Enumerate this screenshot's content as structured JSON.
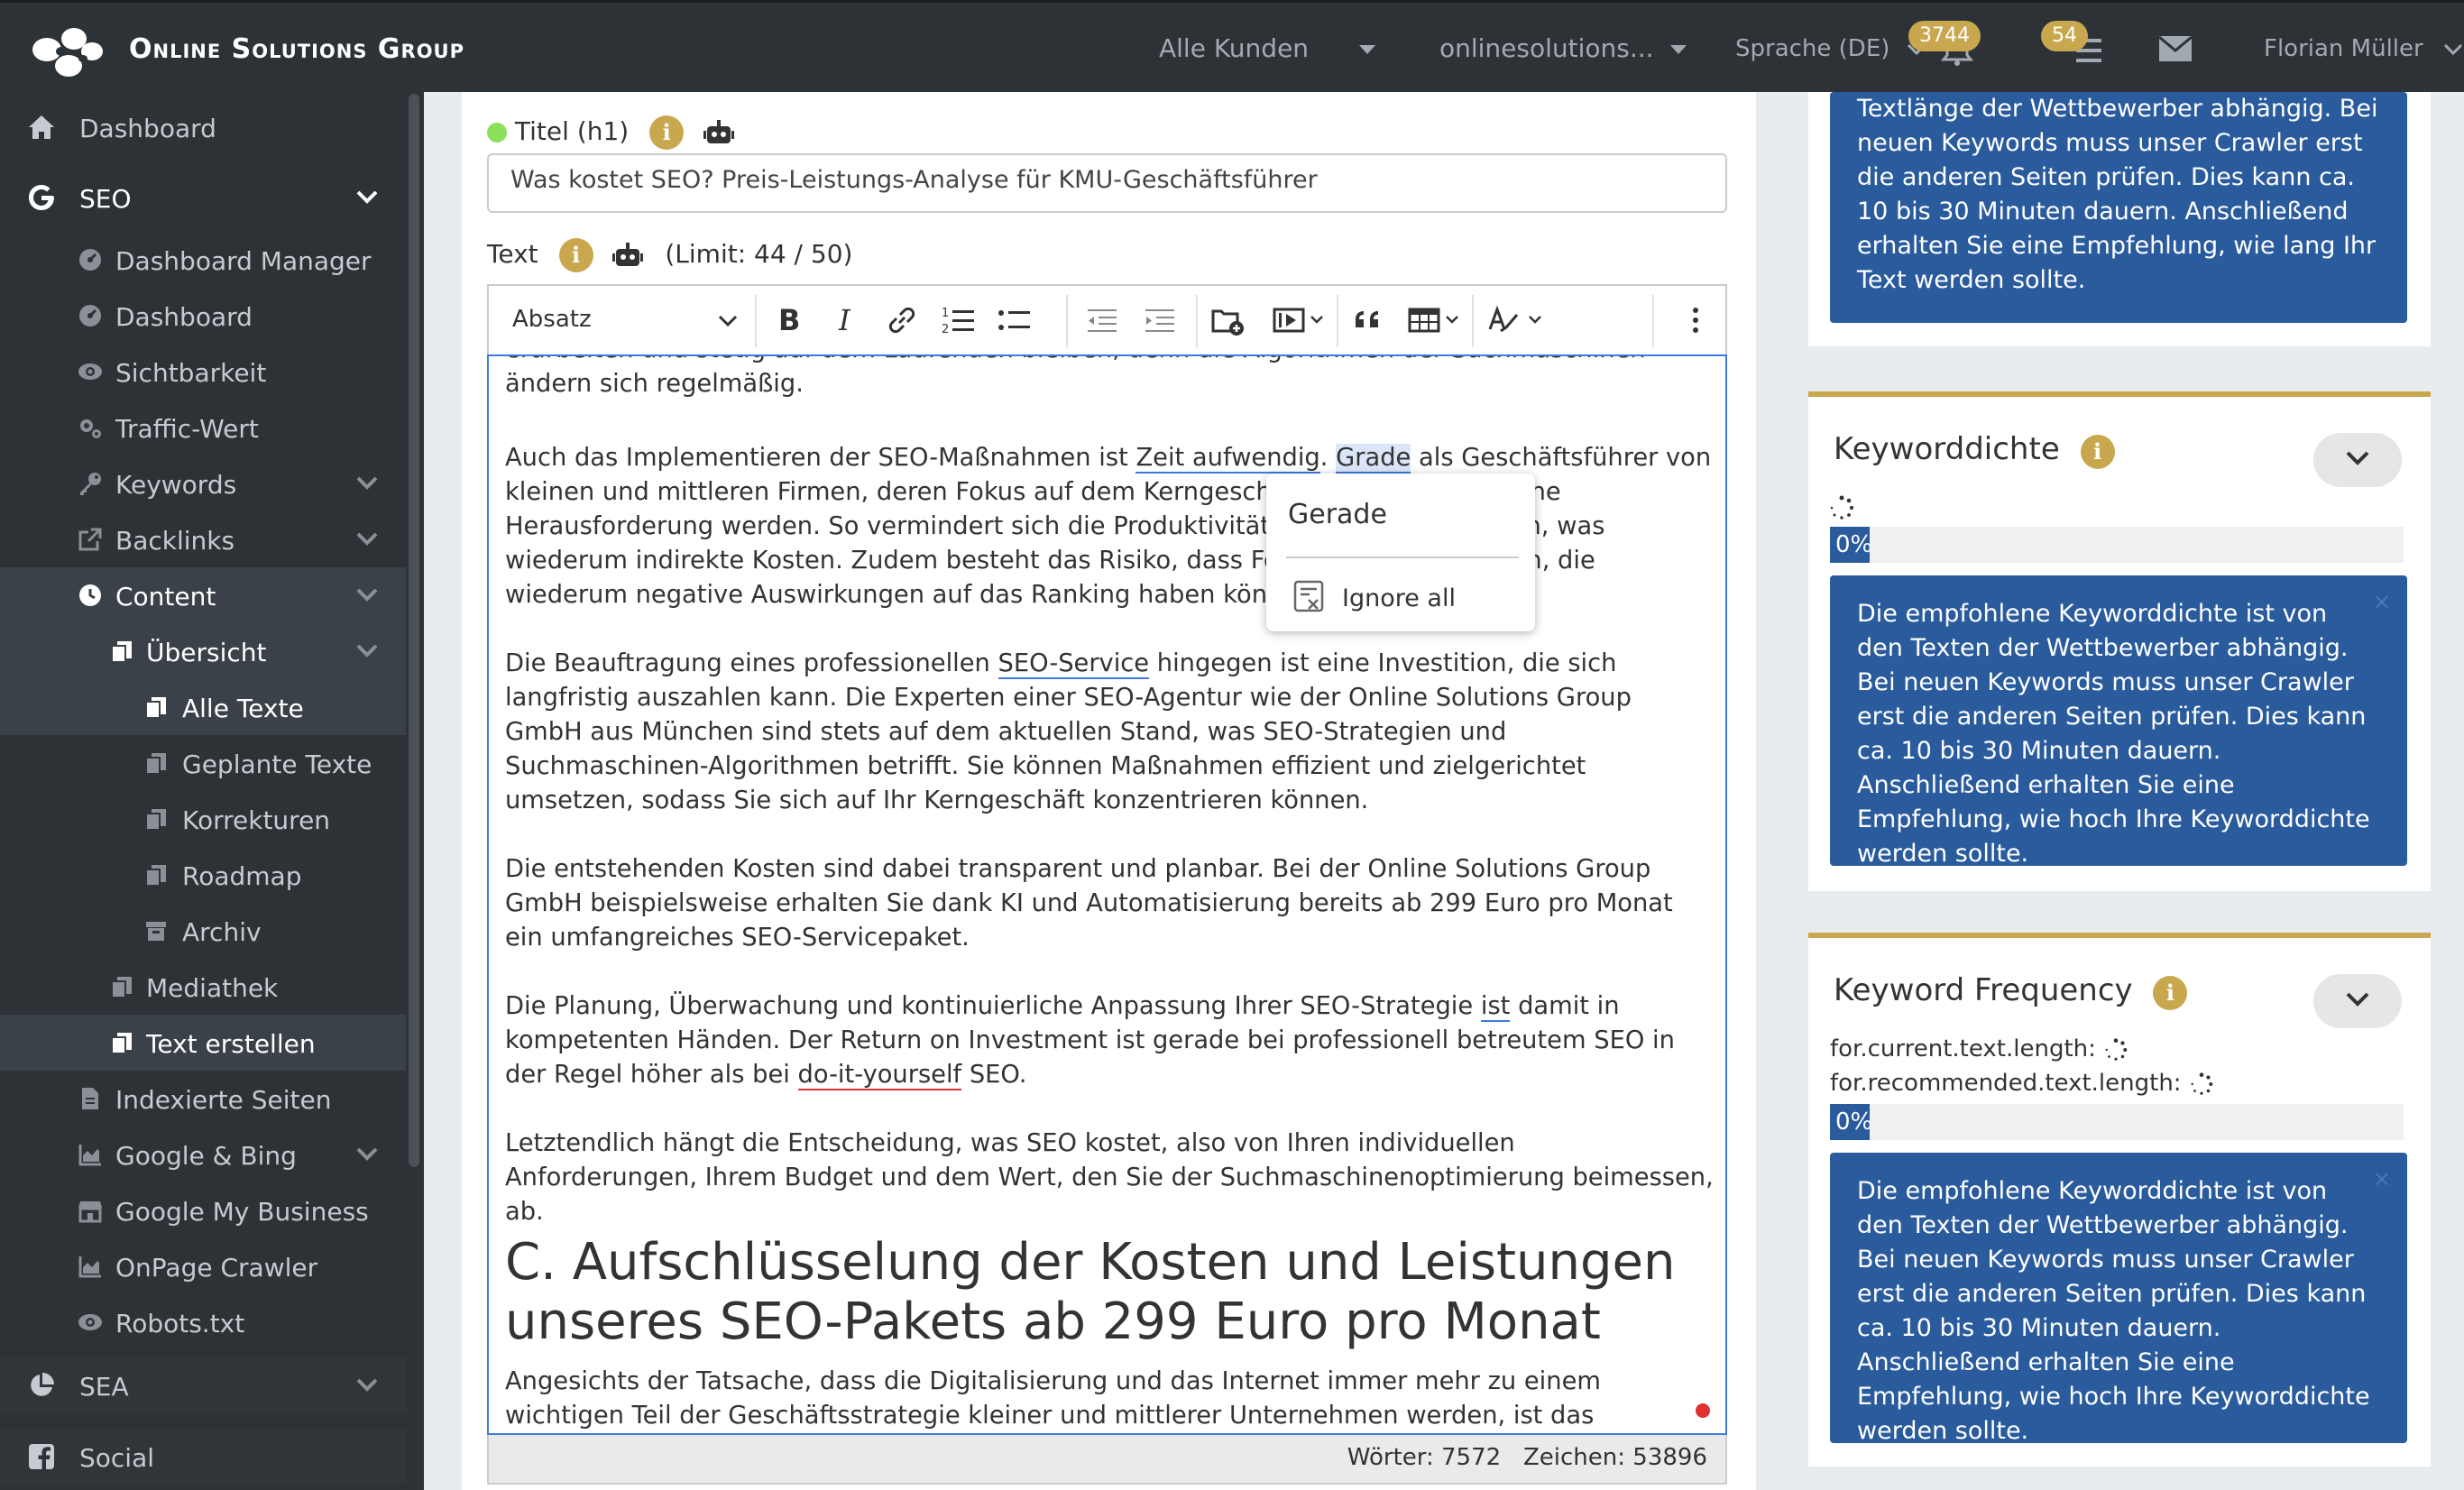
{
  "topbar": {
    "brand": "Online Solutions Group",
    "customers": "Alle Kunden",
    "domain": "onlinesolutions...",
    "language": "Sprache (DE)",
    "notif_count": "3744",
    "tasks_count": "54",
    "user": "Florian Müller"
  },
  "sidebar": {
    "items": [
      {
        "label": "Dashboard",
        "icon": "home-icon"
      },
      {
        "label": "SEO",
        "icon": "google-icon"
      },
      {
        "label": "Dashboard Manager",
        "icon": "dashboard-gauge-icon"
      },
      {
        "label": "Dashboard",
        "icon": "dashboard-gauge-icon"
      },
      {
        "label": "Sichtbarkeit",
        "icon": "eye-icon"
      },
      {
        "label": "Traffic-Wert",
        "icon": "cogs-icon"
      },
      {
        "label": "Keywords",
        "icon": "key-icon"
      },
      {
        "label": "Backlinks",
        "icon": "external-link-icon"
      },
      {
        "label": "Content",
        "icon": "clock-icon"
      },
      {
        "label": "Übersicht",
        "icon": "copy-icon"
      },
      {
        "label": "Alle Texte",
        "icon": "copy-icon"
      },
      {
        "label": "Geplante Texte",
        "icon": "copy-icon"
      },
      {
        "label": "Korrekturen",
        "icon": "copy-icon"
      },
      {
        "label": "Roadmap",
        "icon": "copy-icon"
      },
      {
        "label": "Archiv",
        "icon": "archive-icon"
      },
      {
        "label": "Mediathek",
        "icon": "copy-icon"
      },
      {
        "label": "Text erstellen",
        "icon": "copy-icon"
      },
      {
        "label": "Indexierte Seiten",
        "icon": "file-icon"
      },
      {
        "label": "Google & Bing",
        "icon": "area-chart-icon"
      },
      {
        "label": "Google My Business",
        "icon": "store-icon"
      },
      {
        "label": "OnPage Crawler",
        "icon": "area-chart-icon"
      },
      {
        "label": "Robots.txt",
        "icon": "eye-icon"
      },
      {
        "label": "SEA",
        "icon": "pie-chart-icon"
      },
      {
        "label": "Social",
        "icon": "facebook-icon"
      }
    ]
  },
  "editor": {
    "title_label": "Titel (h1)",
    "title_value": "Was kostet SEO? Preis-Leistungs-Analyse für KMU-Geschäftsführer",
    "text_label": "Text",
    "limit": "(Limit: 44 / 50)",
    "format_select": "Absatz",
    "p0": "erarbeiten und stetig auf dem Laufenden bleiben, denn die Algorithmen der Suchmaschinen ändern sich regelmäßig.",
    "p1a": "Auch das Implementieren der SEO-Maßnahmen ist ",
    "p1b": "Zeit aufwendig",
    "p1c": ". ",
    "p1d": "Grade",
    "p1e": " als Geschäftsführer von kleinen und mittleren Firmen, deren Fokus auf dem Kerngeschäft liegt, kann dies eine Herausforderung werden. So vermindert sich die Produktivität in anderen Bereichen, was wiederum indirekte Kosten. Zudem besteht das Risiko, dass Fehler gemacht werden, die wiederum negative Auswirkungen auf das Ranking haben können.",
    "p2a": "Die Beauftragung eines professionellen ",
    "p2b": "SEO-Service",
    "p2c": " hingegen ist eine Investition, die sich langfristig auszahlen kann. Die Experten einer SEO-Agentur wie der Online Solutions Group GmbH aus München sind stets auf dem aktuellen Stand, was SEO-Strategien und Suchmaschinen-Algorithmen betrifft. Sie können Maßnahmen effizient und zielgerichtet umsetzen, sodass Sie sich auf Ihr Kerngeschäft konzentrieren können.",
    "p3": "Die entstehenden Kosten sind dabei transparent und planbar. Bei der Online Solutions Group GmbH beispielsweise erhalten Sie dank KI und Automatisierung bereits ab 299 Euro pro Monat ein umfangreiches SEO-Servicepaket.",
    "p4a": "Die Planung, Überwachung und kontinuierliche Anpassung Ihrer SEO-Strategie ",
    "p4b": "ist",
    "p4c": " damit in kompetenten Händen. Der Return on Investment ist gerade bei professionell betreutem SEO in der Regel höher als bei ",
    "p4d": "do-it-yourself",
    "p4e": " SEO.",
    "p5": "Letztendlich hängt die Entscheidung, was SEO kostet, also von Ihren individuellen Anforderungen, Ihrem Budget und dem Wert, den Sie der Suchmaschinenoptimierung beimessen, ab.",
    "h2": "C. Aufschlüsselung der Kosten und Leistungen unseres SEO-Pakets ab 299 Euro pro Monat",
    "p6": "Angesichts der Tatsache, dass die Digitalisierung und das Internet immer mehr zu einem wichtigen Teil der Geschäftsstrategie kleiner und mittlerer Unternehmen werden, ist das Verständnis der SEO-Kosten",
    "words": "Wörter: 7572",
    "chars": "Zeichen: 53896"
  },
  "context_menu": {
    "suggestion": "Gerade",
    "ignore_all": "Ignore all"
  },
  "right": {
    "card0_text": "Textlänge der Wettbewerber abhängig. Bei neuen Keywords muss unser Crawler erst die anderen Seiten prüfen. Dies kann ca. 10 bis 30 Minuten dauern. Anschließend erhalten Sie eine Empfehlung, wie lang Ihr Text werden sollte.",
    "card1_title": "Keyworddichte",
    "card1_progress": "0%",
    "card1_progress_value": 0,
    "card1_text": "Die empfohlene Keyworddichte ist von den Texten der Wettbewerber abhängig. Bei neuen Keywords muss unser Crawler erst die anderen Seiten prüfen. Dies kann ca. 10 bis 30 Minuten dauern. Anschließend erhalten Sie eine Empfehlung, wie hoch Ihre Keyworddichte werden sollte.",
    "card2_title": "Keyword Frequency",
    "card2_line1": "for.current.text.length:",
    "card2_line2": "for.recommended.text.length:",
    "card2_progress": "0%",
    "card2_progress_value": 0,
    "card2_text": "Die empfohlene Keyworddichte ist von den Texten der Wettbewerber abhängig. Bei neuen Keywords muss unser Crawler erst die anderen Seiten prüfen. Dies kann ca. 10 bis 30 Minuten dauern. Anschließend erhalten Sie eine Empfehlung, wie hoch Ihre Keyworddichte werden sollte.",
    "close_symbol": "×"
  },
  "colors": {
    "accent_gold": "#c9a74e",
    "panel_blue": "#2a5b9c",
    "sidebar_bg": "#2d3237",
    "editor_focus": "#3e7ae0"
  }
}
